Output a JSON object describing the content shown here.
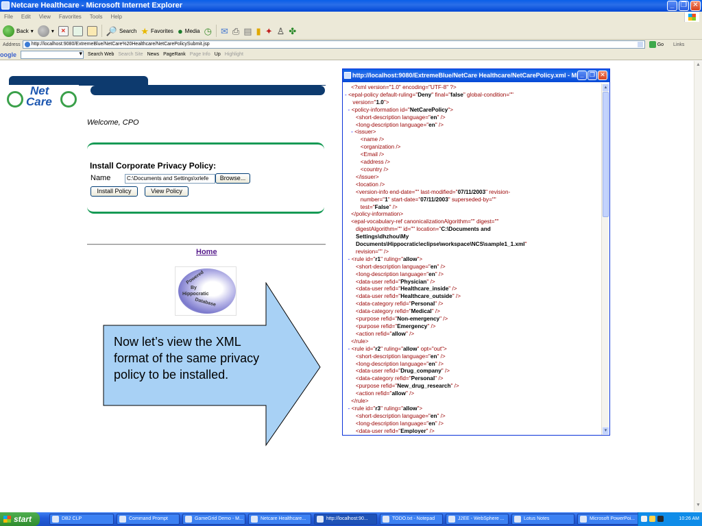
{
  "window": {
    "title": "Netcare Healthcare - Microsoft Internet Explorer",
    "minimize": "_",
    "maximize": "❐",
    "close": "✕"
  },
  "menu": [
    "File",
    "Edit",
    "View",
    "Favorites",
    "Tools",
    "Help"
  ],
  "toolbar": {
    "back": "Back",
    "search": "Search",
    "favorites": "Favorites",
    "media": "Media"
  },
  "address": {
    "label": "Address",
    "url": "http://localhost:9080/ExtremeBlue/NetCare%20Healthcare/NetCarePolicySubmit.jsp",
    "go": "Go",
    "links": "Links"
  },
  "google_bar": {
    "logo": "oogle",
    "search_web": "Search Web",
    "search_site": "Search Site",
    "news": "News",
    "pagerank": "PageRank",
    "page_info": "Page Info",
    "up": "Up",
    "highlight": "Highlight"
  },
  "page": {
    "logo_net": "Net",
    "logo_care": "Care",
    "welcome": "Welcome, CPO",
    "panel_title": "Install Corporate Privacy Policy:",
    "name_label": "Name",
    "file_value": "C:\\Documents and Settings\\xrlefe",
    "browse": "Browse...",
    "install": "Install Policy",
    "view": "View Policy",
    "home": "Home",
    "powered": [
      "Powered",
      "By",
      "Hippocratic",
      "Database"
    ]
  },
  "callout": {
    "text": "Now let’s view the XML format of the same privacy policy to be installed."
  },
  "popup": {
    "title": "http://localhost:9080/ExtremeBlue/NetCare Healthcare/NetCarePolicy.xml - Mic..."
  },
  "xml_lines": [
    {
      "m": "",
      "t": "    <?xml version=\"1.0\" encoding=\"UTF-8\" ?>"
    },
    {
      "m": "- ",
      "t": "<epal-policy default-ruling=\"",
      "v": "Deny",
      "r": "\" final=\"",
      "v2": "false",
      "r2": "\" global-condition=\"\""
    },
    {
      "m": "",
      "t": "     version=\"",
      "v": "1.0",
      "r": "\">"
    },
    {
      "m": "  - ",
      "t": "<policy-information id=\"",
      "v": "NetCarePolicy",
      "r": "\">"
    },
    {
      "m": "",
      "t": "       <short-description language=\"",
      "v": "en",
      "r": "\" />"
    },
    {
      "m": "",
      "t": "       <long-description language=\"",
      "v": "en",
      "r": "\" />"
    },
    {
      "m": "    - ",
      "t": "<issuer>"
    },
    {
      "m": "",
      "t": "          <name />"
    },
    {
      "m": "",
      "t": "          <organization />"
    },
    {
      "m": "",
      "t": "          <Email />"
    },
    {
      "m": "",
      "t": "          <address />"
    },
    {
      "m": "",
      "t": "          <country />"
    },
    {
      "m": "",
      "t": "       </issuer>"
    },
    {
      "m": "",
      "t": "       <location />"
    },
    {
      "m": "",
      "t": "       <version-info end-date=\"\" last-modified=\"",
      "v": "07/11/2003",
      "r": "\" revision-"
    },
    {
      "m": "",
      "t": "          number=\"",
      "v": "1",
      "r": "\" start-date=\"",
      "v2": "07/11/2003",
      "r2": "\" superseded-by=\"\""
    },
    {
      "m": "",
      "t": "          test=\"",
      "v": "False",
      "r": "\" />"
    },
    {
      "m": "",
      "t": "    </policy-information>"
    },
    {
      "m": "",
      "t": "    <epal-vocabulary-ref canonicalizationAlgorithm=\"\" digest=\"\""
    },
    {
      "m": "",
      "t": "       digestAlgorithm=\"\" id=\"\" location=\"",
      "v": "C:\\Documents and",
      "r": ""
    },
    {
      "m": "",
      "t": "       ",
      "v": "Settings\\dhzhou\\My",
      "r": ""
    },
    {
      "m": "",
      "t": "       ",
      "v": "Documents\\Hippocratic\\eclipse\\workspace\\NCS\\sample1_1.xml",
      "r": "\""
    },
    {
      "m": "",
      "t": "       revision=\"\" />"
    },
    {
      "m": "  - ",
      "t": "<rule id=\"",
      "v": "r1",
      "r": "\" ruling=\"",
      "v2": "allow",
      "r2": "\">"
    },
    {
      "m": "",
      "t": "       <short-description language=\"",
      "v": "en",
      "r": "\" />"
    },
    {
      "m": "",
      "t": "       <long-description language=\"",
      "v": "en",
      "r": "\" />"
    },
    {
      "m": "",
      "t": "       <data-user refid=\"",
      "v": "Physician",
      "r": "\" />"
    },
    {
      "m": "",
      "t": "       <data-user refid=\"",
      "v": "Healthcare_inside",
      "r": "\" />"
    },
    {
      "m": "",
      "t": "       <data-user refid=\"",
      "v": "Healthcare_outside",
      "r": "\" />"
    },
    {
      "m": "",
      "t": "       <data-category refid=\"",
      "v": "Personal",
      "r": "\" />"
    },
    {
      "m": "",
      "t": "       <data-category refid=\"",
      "v": "Medical",
      "r": "\" />"
    },
    {
      "m": "",
      "t": "       <purpose refid=\"",
      "v": "Non-emergency",
      "r": "\" />"
    },
    {
      "m": "",
      "t": "       <purpose refid=\"",
      "v": "Emergency",
      "r": "\" />"
    },
    {
      "m": "",
      "t": "       <action refid=\"",
      "v": "allow",
      "r": "\" />"
    },
    {
      "m": "",
      "t": "    </rule>"
    },
    {
      "m": "  - ",
      "t": "<rule id=\"",
      "v": "r2",
      "r": "\" ruling=\"",
      "v2": "allow",
      "r2": "\" opt=\"out\">"
    },
    {
      "m": "",
      "t": "       <short-description language=\"",
      "v": "en",
      "r": "\" />"
    },
    {
      "m": "",
      "t": "       <long-description language=\"",
      "v": "en",
      "r": "\" />"
    },
    {
      "m": "",
      "t": "       <data-user refid=\"",
      "v": "Drug_company",
      "r": "\" />"
    },
    {
      "m": "",
      "t": "       <data-category refid=\"",
      "v": "Personal",
      "r": "\" />"
    },
    {
      "m": "",
      "t": "       <purpose refid=\"",
      "v": "New_drug_research",
      "r": "\" />"
    },
    {
      "m": "",
      "t": "       <action refid=\"",
      "v": "allow",
      "r": "\" />"
    },
    {
      "m": "",
      "t": "    </rule>"
    },
    {
      "m": "  - ",
      "t": "<rule id=\"",
      "v": "r3",
      "r": "\" ruling=\"",
      "v2": "allow",
      "r2": "\">"
    },
    {
      "m": "",
      "t": "       <short-description language=\"",
      "v": "en",
      "r": "\" />"
    },
    {
      "m": "",
      "t": "       <long-description language=\"",
      "v": "en",
      "r": "\" />"
    },
    {
      "m": "",
      "t": "       <data-user refid=\"",
      "v": "Employer",
      "r": "\" />"
    }
  ],
  "taskbar": {
    "start": "start",
    "tasks": [
      "DB2 CLP",
      "Command Prompt",
      "GameGrid Demo - M...",
      "Netcare Healthcare...",
      "http://localhost:90...",
      "TODO.txt - Notepad",
      "J2EE - WebSphere ...",
      "Lotus Notes",
      "Microsoft PowerPoi..."
    ],
    "clock": "10:26 AM"
  },
  "colors": {
    "brand_navy": "#0d3a6e",
    "panel_green": "#169a55",
    "xp_blue": "#245edb",
    "callout_blue": "#a8d1f5"
  }
}
